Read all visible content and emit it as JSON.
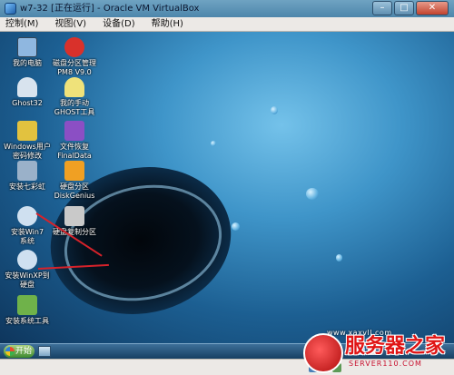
{
  "window": {
    "title": "w7-32 [正在运行] - Oracle VM VirtualBox",
    "buttons": {
      "minimize": "–",
      "maximize": "□",
      "close": "✕"
    }
  },
  "menu": [
    "控制(M)",
    "视图(V)",
    "设备(D)",
    "帮助(H)"
  ],
  "desktop_icons": [
    {
      "label": "我的电脑",
      "icon": "computer-icon",
      "color": "#8fb7e0"
    },
    {
      "label": "磁盘分区管理\nPM8 V9.0",
      "icon": "partition-magic-icon",
      "color": "#d9312b"
    },
    {
      "label": "Ghost32",
      "icon": "ghost-icon",
      "color": "#d8e3ee"
    },
    {
      "label": "我的手动\nGHOST工具",
      "icon": "ghost-tool-icon",
      "color": "#efe27a"
    },
    {
      "label": "Windows用户\n密码修改",
      "icon": "key-icon",
      "color": "#e2c23f"
    },
    {
      "label": "文件恢复\nFinalData",
      "icon": "puzzle-icon",
      "color": "#8b4fc4"
    },
    {
      "label": "安装七彩虹",
      "icon": "setup-icon",
      "color": "#9ab1c9"
    },
    {
      "label": "硬盘分区\nDiskGenius",
      "icon": "diskgenius-icon",
      "color": "#f0a023"
    },
    {
      "label": "安装Win7\n系统",
      "icon": "win7-disc-icon",
      "color": "#cfe0f0"
    },
    {
      "label": "硬盘复制分区",
      "icon": "disk-copy-icon",
      "color": "#c9c9c9"
    },
    {
      "label": "安装WinXP到\n硬盘",
      "icon": "winxp-disc-icon",
      "color": "#cfe0f0"
    },
    {
      "label": "安装系统工具",
      "icon": "install-tools-icon",
      "color": "#6fb24a"
    }
  ],
  "taskbar": {
    "start_label": "开始"
  },
  "watermark": {
    "site": "www.xaxvll.com",
    "brand": "服务器之家",
    "url": "SERVER110.COM"
  },
  "colors": {
    "arrow": "#d6222a",
    "brand_red": "#e01515"
  }
}
